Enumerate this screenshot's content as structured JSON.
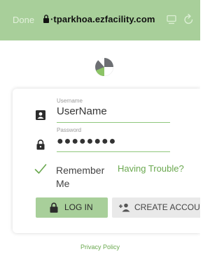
{
  "browser": {
    "done_label": "Done",
    "url": "·tparkhoa.ezfacility.com",
    "bar_color": "#a8cf9a"
  },
  "login": {
    "username": {
      "label": "Username",
      "value": "UserName",
      "icon": "user-card-icon"
    },
    "password": {
      "label": "Password",
      "value": "●●●●●●●●",
      "icon": "lock-icon"
    },
    "remember_label": "Remember Me",
    "remember_checked": true,
    "trouble_link": "Having Trouble?",
    "login_button": "LOG IN",
    "create_button": "CREATE ACCOUNT",
    "accent_color": "#8fc77b"
  },
  "footer": {
    "privacy_link": "Privacy Policy"
  }
}
